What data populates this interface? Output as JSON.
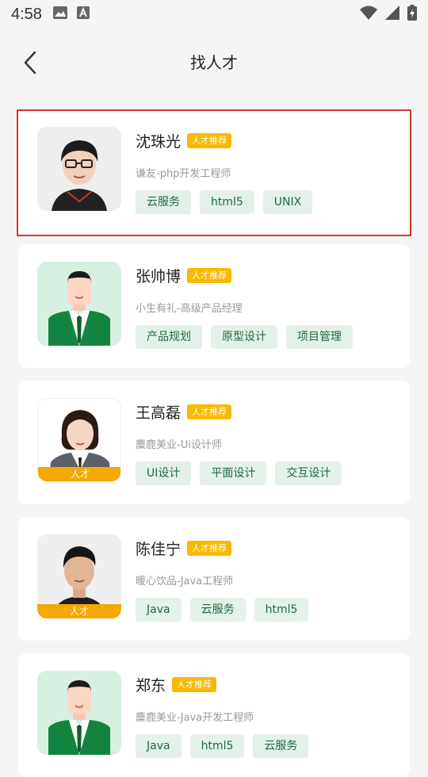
{
  "status_bar": {
    "time": "4:58",
    "icons": [
      "image-icon",
      "font-icon",
      "wifi-icon",
      "signal-icon",
      "battery-icon"
    ]
  },
  "header": {
    "title": "找人才"
  },
  "recommend_label": "人才推荐",
  "avatar_badge_label": "人才",
  "cards": [
    {
      "name": "沈珠光",
      "title": "谦友-php开发工程师",
      "tags": [
        "云服务",
        "html5",
        "UNIX"
      ]
    },
    {
      "name": "张帅博",
      "title": "小生有礼-高级产品经理",
      "tags": [
        "产品规划",
        "原型设计",
        "项目管理"
      ]
    },
    {
      "name": "王高磊",
      "title": "麋鹿美业-Ui设计师",
      "tags": [
        "UI设计",
        "平面设计",
        "交互设计"
      ]
    },
    {
      "name": "陈佳宁",
      "title": "暖心饮品-Java工程师",
      "tags": [
        "Java",
        "云服务",
        "html5"
      ]
    },
    {
      "name": "郑东",
      "title": "麋鹿美业-Java开发工程师",
      "tags": [
        "Java",
        "html5",
        "云服务"
      ]
    }
  ],
  "colors": {
    "selection_border": "#d73434",
    "badge": "#f9b800",
    "tag_bg": "#e4f1e8",
    "tag_text": "#1e6a45"
  }
}
